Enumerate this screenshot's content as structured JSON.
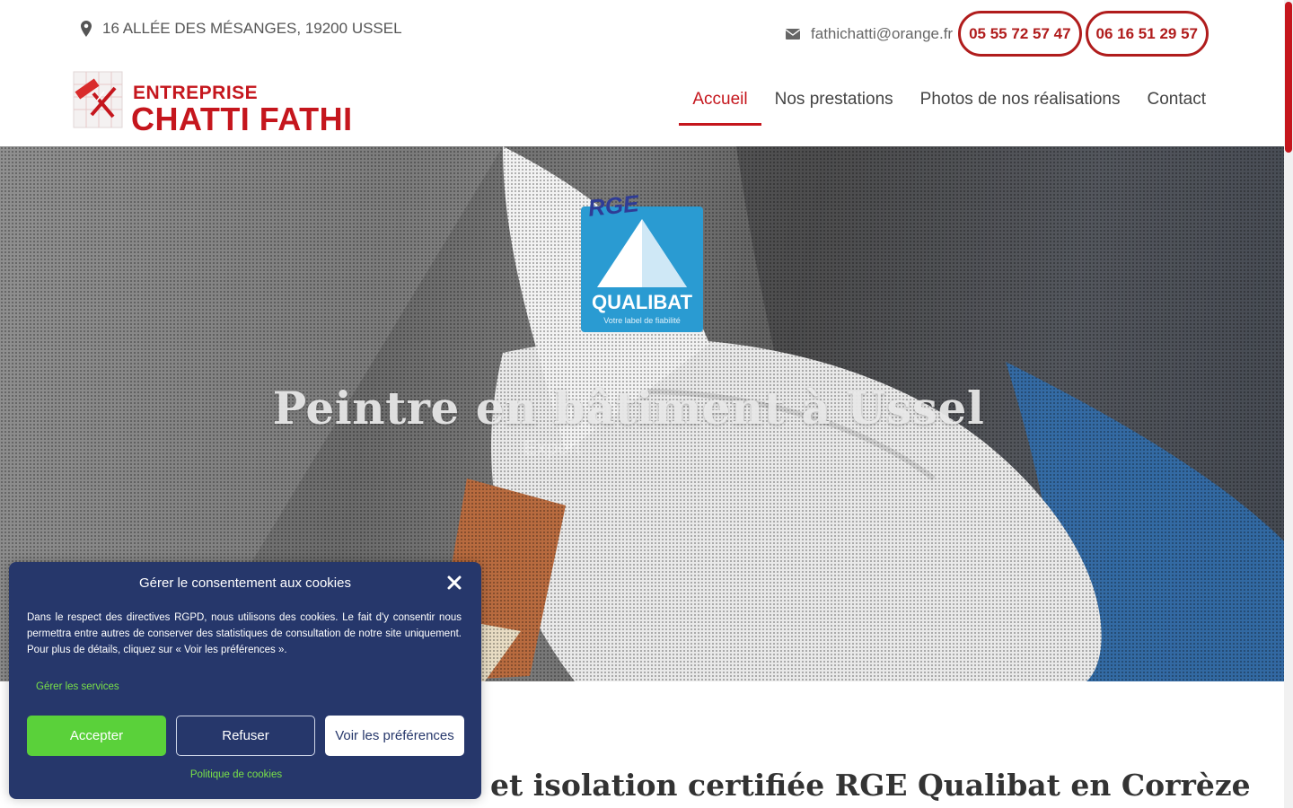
{
  "topbar": {
    "address": "16 ALLÉE DES MÉSANGES, 19200 USSEL",
    "email": "fathichatti@orange.fr",
    "phone1": "05 55 72 57 47",
    "phone2": "06 16 51 29 57"
  },
  "logo": {
    "line1": "ENTREPRISE",
    "line2": "CHATTI FATHI"
  },
  "nav": {
    "items": [
      {
        "label": "Accueil",
        "active": true
      },
      {
        "label": "Nos prestations"
      },
      {
        "label": "Photos de nos réalisations"
      },
      {
        "label": "Contact"
      }
    ]
  },
  "hero": {
    "badge_top": "RGE",
    "badge_name": "QUALIBAT",
    "badge_tagline": "Votre label de fiabilité",
    "title": "Peintre en bâtiment à Ussel",
    "subtitle": "Expert"
  },
  "section": {
    "title_visible": "et isolation certifiée RGE Qualibat en Corrèze"
  },
  "cookie": {
    "title": "Gérer le consentement aux cookies",
    "text": "Dans le respect des directives RGPD, nous utilisons des cookies. Le fait d'y consentir nous permettra entre autres de conserver des statistiques de consultation de notre site uniquement. Pour plus de détails, cliquez sur « Voir les préférences ».",
    "manage": "Gérer les services",
    "accept": "Accepter",
    "refuse": "Refuser",
    "prefs": "Voir les préférences",
    "policy": "Politique de cookies"
  },
  "colors": {
    "brand_red": "#c5161d",
    "cookie_bg": "#26376b",
    "accept_green": "#5ad13a",
    "link_green": "#79e048",
    "qualibat_blue": "#2a9bd2"
  }
}
